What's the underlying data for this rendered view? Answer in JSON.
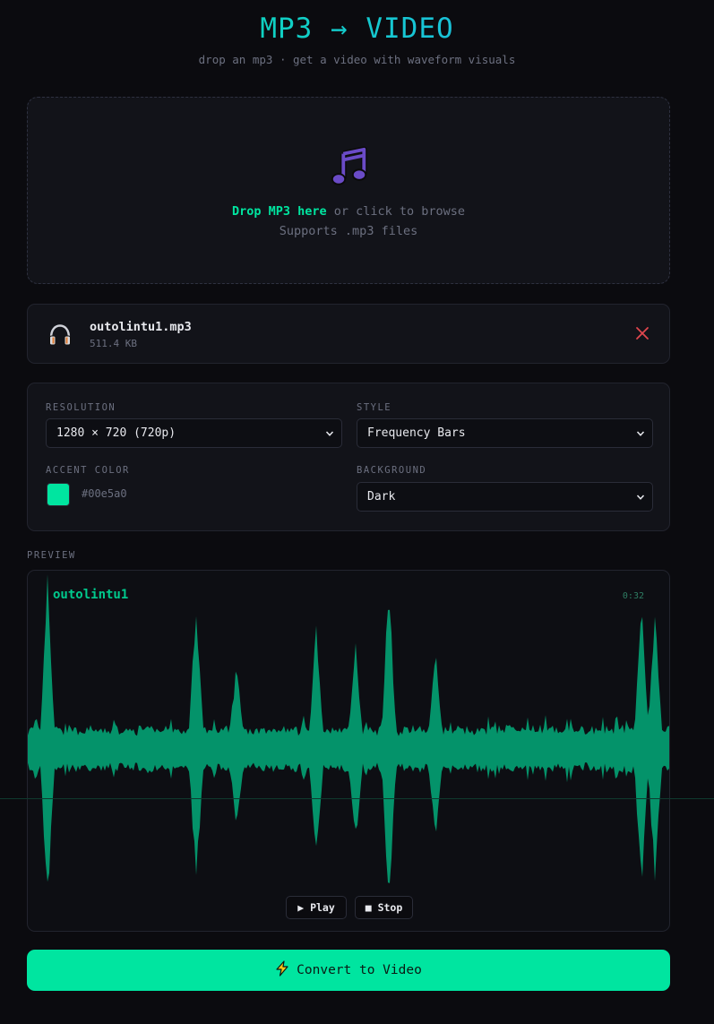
{
  "header": {
    "title": "MP3 → VIDEO",
    "subtitle": "drop an mp3 · get a video with waveform visuals"
  },
  "dropzone": {
    "strong": "Drop MP3 here",
    "rest": " or click to browse",
    "supports": "Supports .mp3 files",
    "icon": "music-note-icon"
  },
  "file": {
    "name": "outolintu1.mp3",
    "size": "511.4 KB",
    "icon": "headphones-icon"
  },
  "settings": {
    "resolution_label": "RESOLUTION",
    "resolution_value": "1280 × 720 (720p)",
    "style_label": "STYLE",
    "style_value": "Frequency Bars",
    "accent_label": "ACCENT COLOR",
    "accent_value": "#00e5a0",
    "background_label": "BACKGROUND",
    "background_value": "Dark"
  },
  "preview": {
    "label": "PREVIEW",
    "track_title": "outolintu1",
    "duration": "0:32",
    "play_label": "▶ Play",
    "stop_label": "■ Stop"
  },
  "convert": {
    "label": "Convert to Video"
  },
  "colors": {
    "accent": "#00e5a0",
    "background": "#0b0b0f",
    "panel": "#121319",
    "remove": "#e0464e"
  }
}
